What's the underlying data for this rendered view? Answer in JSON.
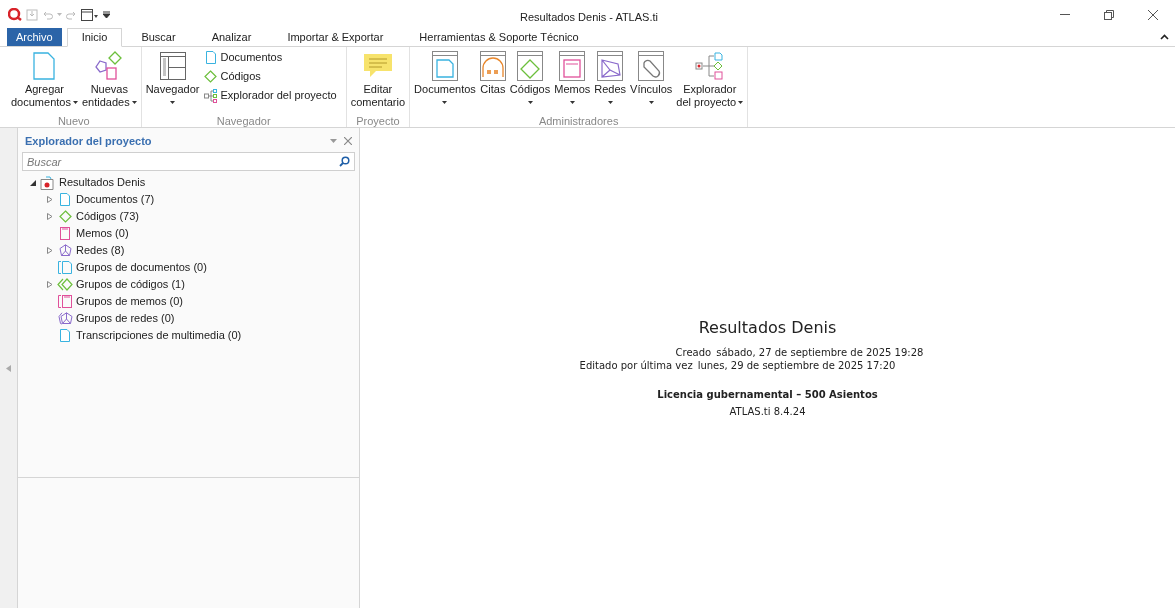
{
  "window": {
    "title": "Resultados Denis - ATLAS.ti"
  },
  "tabs": [
    {
      "label": "Archivo",
      "kind": "file",
      "selected": false
    },
    {
      "label": "Inicio",
      "kind": "tab",
      "selected": true
    },
    {
      "label": "Buscar",
      "kind": "tab",
      "selected": false
    },
    {
      "label": "Analizar",
      "kind": "tab",
      "selected": false
    },
    {
      "label": "Importar & Exportar",
      "kind": "tab",
      "selected": false
    },
    {
      "label": "Herramientas & Soporte Técnico",
      "kind": "tab",
      "selected": false
    }
  ],
  "ribbon_groups": [
    {
      "label": "Nuevo",
      "items": [
        {
          "kind": "large",
          "lines": [
            "Agregar",
            "documentos"
          ],
          "dropdown": true
        },
        {
          "kind": "large",
          "lines": [
            "Nuevas",
            "entidades"
          ],
          "dropdown": true
        }
      ]
    },
    {
      "label": "Navegador",
      "items": [
        {
          "kind": "large",
          "lines": [
            "Navegador"
          ],
          "dropdown": true
        },
        {
          "kind": "small",
          "lines": [
            "Documentos"
          ]
        },
        {
          "kind": "small",
          "lines": [
            "Códigos"
          ]
        },
        {
          "kind": "small",
          "lines": [
            "Explorador del proyecto"
          ]
        }
      ]
    },
    {
      "label": "Proyecto",
      "items": [
        {
          "kind": "large",
          "lines": [
            "Editar",
            "comentario"
          ],
          "dropdown": false
        }
      ]
    },
    {
      "label": "Administradores",
      "items": [
        {
          "kind": "large",
          "lines": [
            "Documentos"
          ],
          "dropdown": true
        },
        {
          "kind": "large",
          "lines": [
            "Citas"
          ],
          "dropdown": false
        },
        {
          "kind": "large",
          "lines": [
            "Códigos"
          ],
          "dropdown": true
        },
        {
          "kind": "large",
          "lines": [
            "Memos"
          ],
          "dropdown": true
        },
        {
          "kind": "large",
          "lines": [
            "Redes"
          ],
          "dropdown": true
        },
        {
          "kind": "large",
          "lines": [
            "Vínculos"
          ],
          "dropdown": true
        },
        {
          "kind": "large",
          "lines": [
            "Explorador",
            "del proyecto"
          ],
          "dropdown": true
        }
      ]
    }
  ],
  "explorer": {
    "title": "Explorador del proyecto",
    "search": {
      "placeholder": "Buscar"
    },
    "tree": [
      {
        "label": "Resultados Denis",
        "expandable": true,
        "expanded": true,
        "children": [
          {
            "label": "Documentos (7)",
            "expandable": true,
            "expanded": false
          },
          {
            "label": "Códigos (73)",
            "expandable": true,
            "expanded": false
          },
          {
            "label": "Memos (0)",
            "expandable": false,
            "expanded": false
          },
          {
            "label": "Redes (8)",
            "expandable": true,
            "expanded": false
          },
          {
            "label": "Grupos de documentos (0)",
            "expandable": false,
            "expanded": false
          },
          {
            "label": "Grupos de códigos (1)",
            "expandable": true,
            "expanded": false
          },
          {
            "label": "Grupos de memos (0)",
            "expandable": false,
            "expanded": false
          },
          {
            "label": "Grupos de redes (0)",
            "expandable": false,
            "expanded": false
          },
          {
            "label": "Transcripciones de multimedia (0)",
            "expandable": false,
            "expanded": false
          }
        ]
      }
    ]
  },
  "project_info": {
    "title": "Resultados Denis",
    "created": {
      "label": "Creado",
      "value": "sábado, 27 de septiembre de 2025 19:28"
    },
    "edited": {
      "label": "Editado por última vez",
      "value": "lunes, 29 de septiembre de 2025 17:20"
    },
    "license": "Licencia gubernamental – 500 Asientos",
    "version": "ATLAS.ti 8.4.24"
  }
}
